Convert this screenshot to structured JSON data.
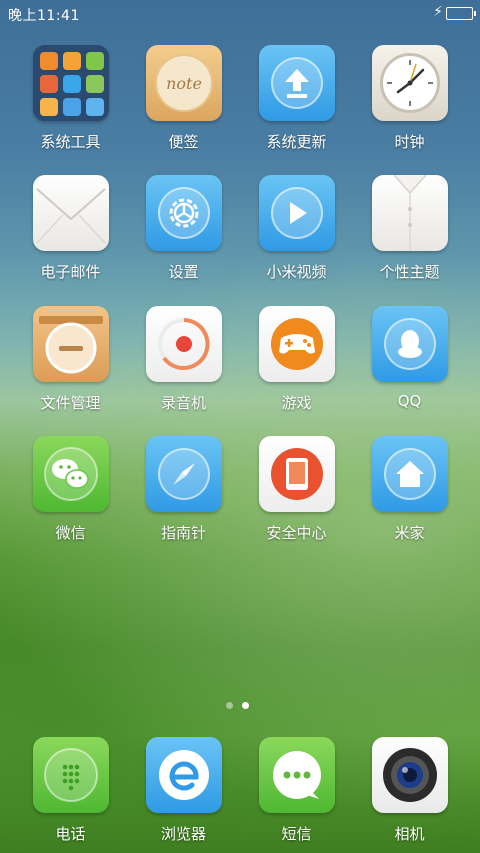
{
  "status_bar": {
    "time": "晚上11:41",
    "charging_glyph": "⚡",
    "battery_level": 1.0
  },
  "apps": {
    "system_tools": "系统工具",
    "notes": "便签",
    "notes_icon_text": "note",
    "system_update": "系统更新",
    "clock": "时钟",
    "email": "电子邮件",
    "settings": "设置",
    "mi_video": "小米视频",
    "themes": "个性主题",
    "file_manager": "文件管理",
    "recorder": "录音机",
    "games": "游戏",
    "qq": "QQ",
    "wechat": "微信",
    "compass": "指南针",
    "security": "安全中心",
    "mi_home": "米家"
  },
  "dock": {
    "phone": "电话",
    "browser": "浏览器",
    "messaging": "短信",
    "camera": "相机"
  },
  "pages": {
    "count": 2,
    "active_index": 1
  },
  "colors": {
    "accent_blue": "#2f9ae5",
    "accent_green": "#4fb833",
    "accent_orange": "#dc9d56",
    "record_red": "#e8463a",
    "games_orange": "#f08a1c"
  }
}
